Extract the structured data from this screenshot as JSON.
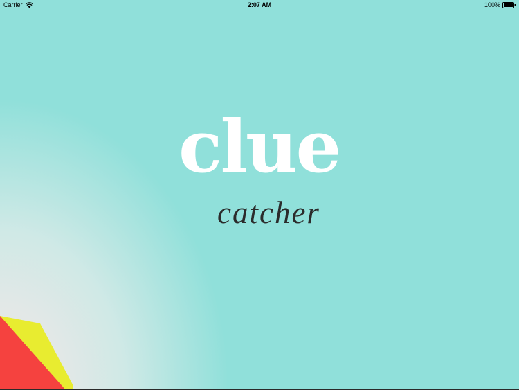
{
  "status_bar": {
    "carrier": "Carrier",
    "time": "2:07 AM",
    "battery": "100%",
    "icons": [
      "wifi-icon",
      "battery-icon"
    ]
  },
  "logo": {
    "primary": "clue",
    "secondary": "catcher"
  },
  "colors": {
    "background": "#90e0da",
    "logo_primary": "#ffffff",
    "logo_secondary": "#2b2b2b",
    "corner_red": "#f5423f",
    "corner_yellow": "#e8ec30"
  }
}
